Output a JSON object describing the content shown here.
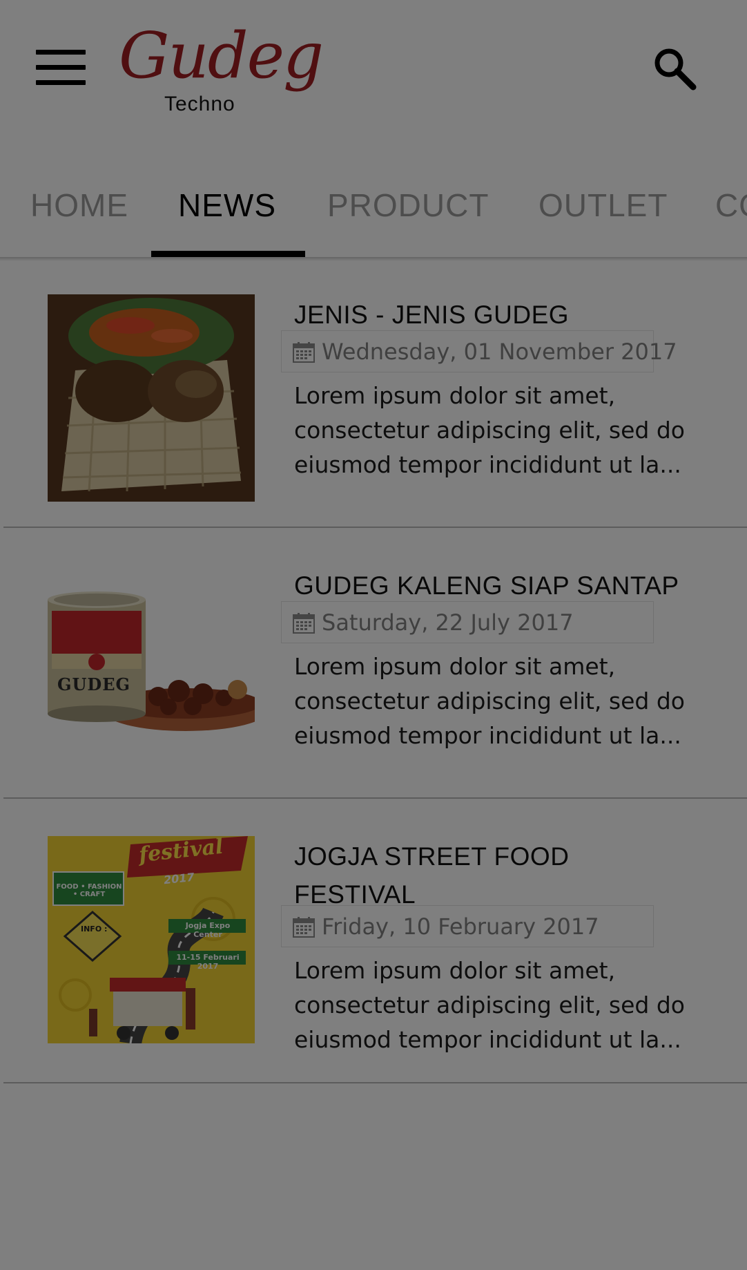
{
  "header": {
    "brand_script": "Gudeg",
    "brand_sub": "Techno"
  },
  "icons": {
    "menu": "hamburger-menu-icon",
    "search": "search-icon",
    "date": "calendar-icon"
  },
  "tabs": [
    {
      "label": "HOME",
      "active": false
    },
    {
      "label": "NEWS",
      "active": true
    },
    {
      "label": "PRODUCT",
      "active": false
    },
    {
      "label": "OUTLET",
      "active": false
    },
    {
      "label": "CO",
      "active": false
    }
  ],
  "news": [
    {
      "title": "JENIS - JENIS GUDEG",
      "date": "Wednesday, 01 November 2017",
      "excerpt": "Lorem ipsum dolor sit amet, consectetur adipiscing elit, sed do eiusmod tempor incididunt ut la...",
      "image": "gudeg-basket-photo"
    },
    {
      "title": "GUDEG KALENG SIAP SANTAP",
      "date": "Saturday, 22 July 2017",
      "excerpt": "Lorem ipsum dolor sit amet, consectetur adipiscing elit, sed do eiusmod tempor incididunt ut la...",
      "image": "gudeg-can-photo",
      "can_label": "GUDEG"
    },
    {
      "title": "JOGJA STREET FOOD FESTIVAL",
      "date": "Friday, 10 February 2017",
      "excerpt": "Lorem ipsum dolor sit amet, consectetur adipiscing elit, sed do eiusmod tempor incididunt ut la...",
      "image": "festival-poster",
      "poster": {
        "banner": "festival",
        "year": "2017",
        "tag": "FOOD • FASHION • CRAFT",
        "venue": "Jogja Expo Center",
        "dates": "11-15 Februari 2017",
        "info": "INFO :"
      }
    }
  ],
  "colors": {
    "brand": "#a01e22",
    "overlay": "rgba(0,0,0,0.5)"
  }
}
